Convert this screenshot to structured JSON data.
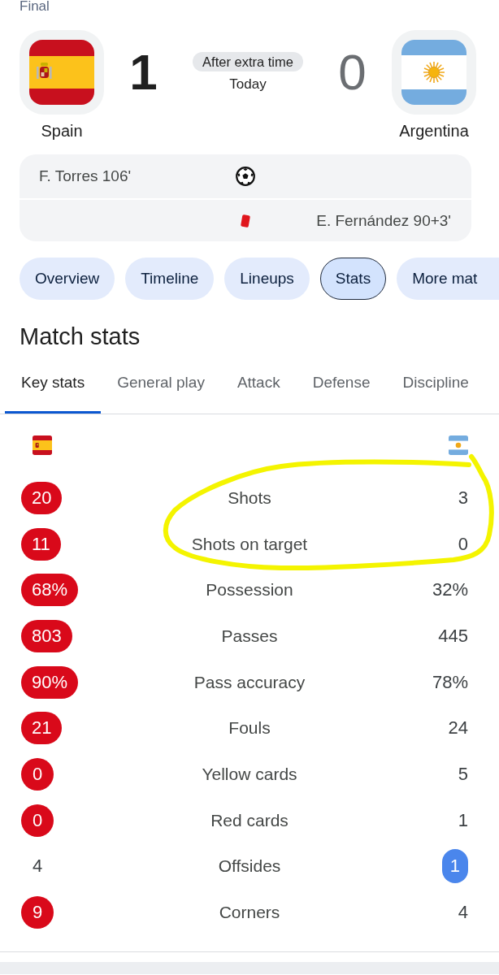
{
  "header": {
    "stage": "Final"
  },
  "match": {
    "teams": [
      {
        "name": "Spain",
        "score": "1",
        "winner": true
      },
      {
        "name": "Argentina",
        "score": "0",
        "winner": false
      }
    ],
    "status": "After extra time",
    "date": "Today"
  },
  "events": [
    {
      "kind": "goal",
      "home": "F. Torres 106'"
    },
    {
      "kind": "red_card",
      "away": "E. Fernández 90+3'"
    }
  ],
  "tabs": [
    {
      "label": "Overview",
      "selected": false
    },
    {
      "label": "Timeline",
      "selected": false
    },
    {
      "label": "Lineups",
      "selected": false
    },
    {
      "label": "Stats",
      "selected": true
    },
    {
      "label": "More mat",
      "selected": false
    }
  ],
  "stats_section": {
    "title": "Match stats",
    "tabs": [
      {
        "label": "Key stats",
        "selected": true
      },
      {
        "label": "General play",
        "selected": false
      },
      {
        "label": "Attack",
        "selected": false
      },
      {
        "label": "Defense",
        "selected": false
      },
      {
        "label": "Discipline",
        "selected": false
      }
    ]
  },
  "stats": [
    {
      "label": "Shots",
      "home": {
        "value": "20",
        "highlighted": true
      },
      "away": {
        "value": "3",
        "highlighted": false
      }
    },
    {
      "label": "Shots on target",
      "home": {
        "value": "11",
        "highlighted": true
      },
      "away": {
        "value": "0",
        "highlighted": false
      }
    },
    {
      "label": "Possession",
      "home": {
        "value": "68%",
        "highlighted": true
      },
      "away": {
        "value": "32%",
        "highlighted": false
      }
    },
    {
      "label": "Passes",
      "home": {
        "value": "803",
        "highlighted": true
      },
      "away": {
        "value": "445",
        "highlighted": false
      }
    },
    {
      "label": "Pass accuracy",
      "home": {
        "value": "90%",
        "highlighted": true
      },
      "away": {
        "value": "78%",
        "highlighted": false
      }
    },
    {
      "label": "Fouls",
      "home": {
        "value": "21",
        "highlighted": true
      },
      "away": {
        "value": "24",
        "highlighted": false
      }
    },
    {
      "label": "Yellow cards",
      "home": {
        "value": "0",
        "highlighted": true
      },
      "away": {
        "value": "5",
        "highlighted": false
      }
    },
    {
      "label": "Red cards",
      "home": {
        "value": "0",
        "highlighted": true
      },
      "away": {
        "value": "1",
        "highlighted": false
      }
    },
    {
      "label": "Offsides",
      "home": {
        "value": "4",
        "highlighted": false
      },
      "away": {
        "value": "1",
        "highlighted": true
      }
    },
    {
      "label": "Corners",
      "home": {
        "value": "9",
        "highlighted": true
      },
      "away": {
        "value": "4",
        "highlighted": false
      }
    }
  ]
}
